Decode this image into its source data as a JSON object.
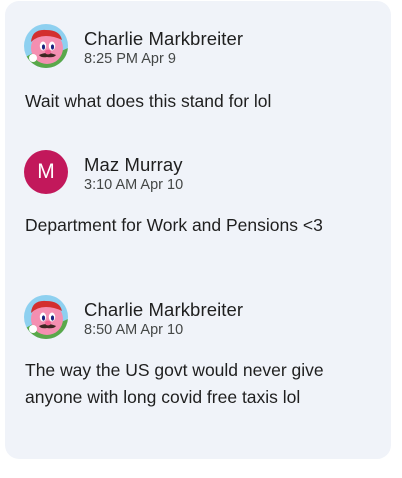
{
  "comments": [
    {
      "author": "Charlie Markbreiter",
      "time": "8:25 PM Apr 9",
      "text": "Wait what does this stand for lol",
      "avatar_icon": "kirby-mario-avatar-icon"
    },
    {
      "author": "Maz Murray",
      "time": "3:10 AM Apr 10",
      "text": "Department for Work and Pensions <3",
      "avatar_letter": "M",
      "avatar_color": "#c2185b"
    },
    {
      "author": "Charlie Markbreiter",
      "time": "8:50 AM Apr 10",
      "text": "The way the US govt would never give anyone with long covid free taxis lol",
      "avatar_icon": "kirby-mario-avatar-icon"
    }
  ],
  "colors": {
    "panel_background": "#f0f3f9",
    "text_primary": "#1f1f1f",
    "text_secondary": "#444746"
  }
}
